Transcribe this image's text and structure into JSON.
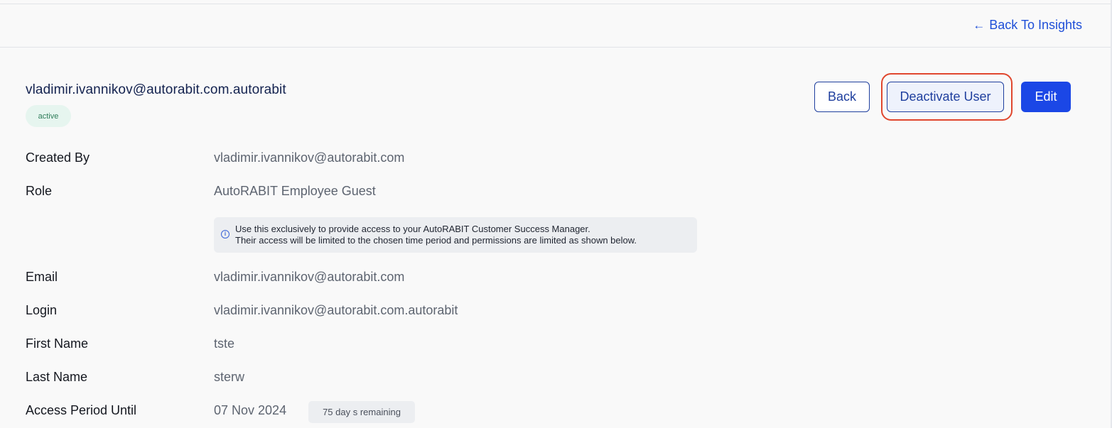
{
  "header": {
    "back_link": "Back To Insights"
  },
  "user": {
    "username": "vladimir.ivannikov@autorabit.com.autorabit",
    "status": "active"
  },
  "actions": {
    "back_label": "Back",
    "deactivate_label": "Deactivate User",
    "edit_label": "Edit"
  },
  "fields": {
    "created_by": {
      "label": "Created By",
      "value": "vladimir.ivannikov@autorabit.com"
    },
    "role": {
      "label": "Role",
      "value": "AutoRABIT Employee Guest"
    },
    "role_info": {
      "line1": "Use this exclusively to provide access to your AutoRABIT Customer Success Manager.",
      "line2": "Their access will be limited to the chosen time period and permissions are limited as shown below."
    },
    "email": {
      "label": "Email",
      "value": "vladimir.ivannikov@autorabit.com"
    },
    "login": {
      "label": "Login",
      "value": "vladimir.ivannikov@autorabit.com.autorabit"
    },
    "first_name": {
      "label": "First Name",
      "value": "tste"
    },
    "last_name": {
      "label": "Last Name",
      "value": "sterw"
    },
    "access_period": {
      "label": "Access Period Until",
      "value": "07 Nov 2024",
      "remaining": "75 day s remaining"
    }
  },
  "colors": {
    "primary": "#1b47e6",
    "outline": "#1f3f9e",
    "highlight": "#e0472e",
    "active_badge_bg": "#e6f5ef"
  }
}
